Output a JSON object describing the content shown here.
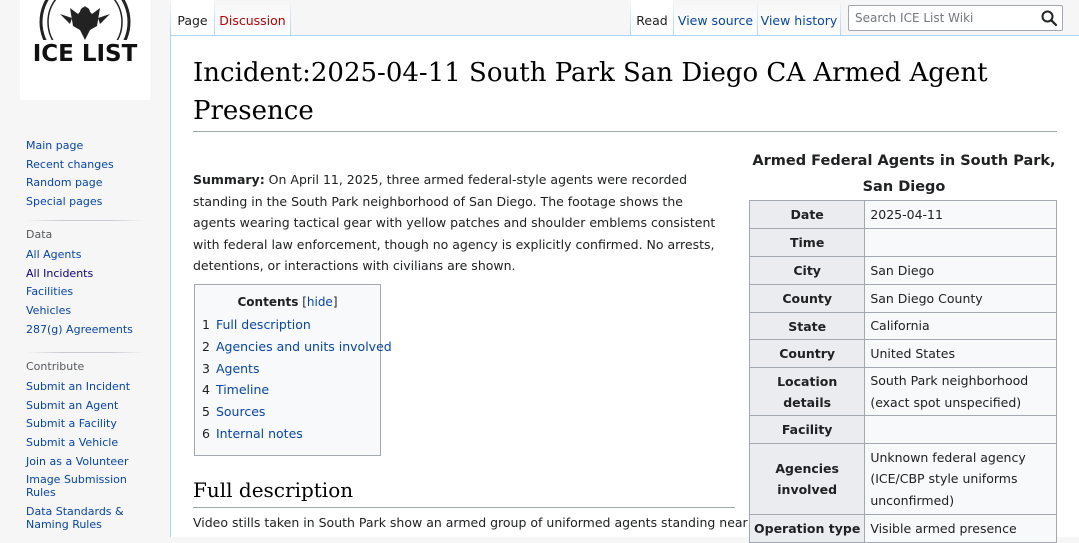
{
  "logo": {
    "text": "ICE LIST"
  },
  "sidebar": {
    "navigation": [
      {
        "label": "Main page"
      },
      {
        "label": "Recent changes"
      },
      {
        "label": "Random page"
      },
      {
        "label": "Special pages"
      }
    ],
    "data_heading": "Data",
    "data": [
      {
        "label": "All Agents"
      },
      {
        "label": "All Incidents"
      },
      {
        "label": "Facilities"
      },
      {
        "label": "Vehicles"
      },
      {
        "label": "287(g) Agreements"
      }
    ],
    "contribute_heading": "Contribute",
    "contribute": [
      {
        "label": "Submit an Incident"
      },
      {
        "label": "Submit an Agent"
      },
      {
        "label": "Submit a Facility"
      },
      {
        "label": "Submit a Vehicle"
      },
      {
        "label": "Join as a Volunteer"
      },
      {
        "label": "Image Submission Rules"
      },
      {
        "label": "Data Standards & Naming Rules"
      }
    ]
  },
  "tabs": {
    "page": "Page",
    "discussion": "Discussion",
    "read": "Read",
    "view_source": "View source",
    "view_history": "View history"
  },
  "search": {
    "placeholder": "Search ICE List Wiki"
  },
  "article": {
    "title": "Incident:2025-04-11 South Park San Diego CA Armed Agent Presence",
    "summary_label": "Summary:",
    "summary_text": " On April 11, 2025, three armed federal-style agents were recorded standing in the South Park neighborhood of San Diego. The footage shows the agents wearing tactical gear with yellow patches and shoulder emblems consistent with federal law enforcement, though no agency is explicitly confirmed. No arrests, detentions, or interactions with civilians are shown.",
    "section_heading": "Full description",
    "section_text": "Video stills taken in South Park show an armed group of uniformed agents standing near a"
  },
  "toc": {
    "title": "Contents",
    "hide_label": "hide",
    "items": [
      {
        "num": "1",
        "label": "Full description"
      },
      {
        "num": "2",
        "label": "Agencies and units involved"
      },
      {
        "num": "3",
        "label": "Agents"
      },
      {
        "num": "4",
        "label": "Timeline"
      },
      {
        "num": "5",
        "label": "Sources"
      },
      {
        "num": "6",
        "label": "Internal notes"
      }
    ]
  },
  "infobox": {
    "caption": "Armed Federal Agents in South Park, San Diego",
    "rows": [
      {
        "label": "Date",
        "value": "2025-04-11"
      },
      {
        "label": "Time",
        "value": ""
      },
      {
        "label": "City",
        "value": "San Diego"
      },
      {
        "label": "County",
        "value": "San Diego County"
      },
      {
        "label": "State",
        "value": "California"
      },
      {
        "label": "Country",
        "value": "United States"
      },
      {
        "label": "Location details",
        "value": "South Park neighborhood (exact spot unspecified)"
      },
      {
        "label": "Facility",
        "value": ""
      },
      {
        "label": "Agencies involved",
        "value": "Unknown federal agency (ICE/CBP style uniforms unconfirmed)"
      },
      {
        "label": "Operation type",
        "value": "Visible armed presence"
      }
    ]
  },
  "colors": {
    "link": "#0645ad",
    "new_link": "#ba0000",
    "border": "#a2a9b1",
    "tab_border": "#a7d7f9"
  }
}
